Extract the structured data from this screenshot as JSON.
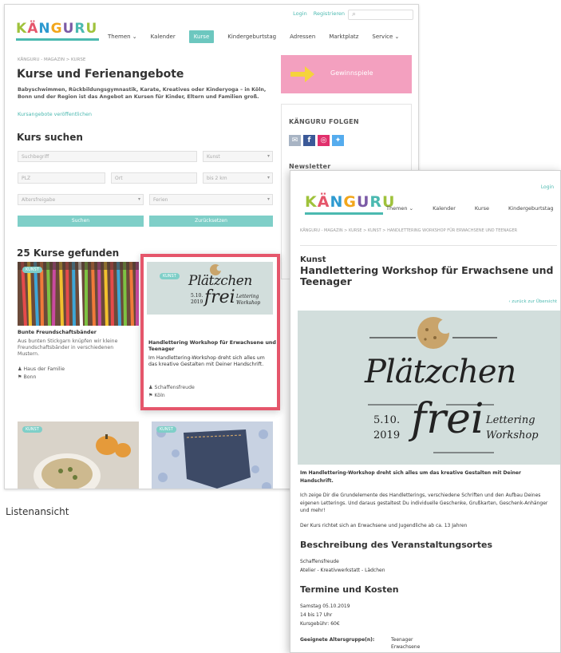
{
  "list": {
    "toplinks": [
      "Login",
      "Registrieren"
    ],
    "logo": "KÄNGURU",
    "nav": [
      "Themen ⌄",
      "Kalender",
      "Kurse",
      "Kindergeburtstag",
      "Adressen",
      "Marktplatz",
      "Service ⌄"
    ],
    "nav_active": 2,
    "breadcrumb": "KÄNGURU - MAGAZIN > KURSE",
    "title": "Kurse und Ferienangebote",
    "intro": "Babyschwimmen, Rückbildungsgymnastik, Karate, Kreatives oder Kinderyoga – in Köln, Bonn und der Region ist das Angebot an Kursen für Kinder, Eltern und Familien groß.",
    "publish_link": "Kursangebote veröffentlichen",
    "search_heading": "Kurs suchen",
    "fields": {
      "keyword": "Suchbegriff",
      "category": "Kunst",
      "plz": "PLZ",
      "ort": "Ort",
      "radius": "bis 2 km",
      "age": "Altersfreigabe",
      "holidays": "Ferien"
    },
    "buttons": {
      "search": "Suchen",
      "reset": "Zurücksetzen"
    },
    "results_heading": "25 Kurse gefunden",
    "cards": [
      {
        "badge": "KUNST",
        "title": "Bunte Freundschaftsbänder",
        "desc": "Aus bunten Stickgarn knüpfen wir kleine Freundschaftsbänder in verschiedenen Mustern.",
        "host": "Haus der Familie",
        "city": "Bonn"
      },
      {
        "badge": "KUNST",
        "title": "Handlettering Workshop für Erwachsene und Teenager",
        "desc": "Im Handlettering-Workshop dreht sich alles um das kreative Gestalten mit Deiner Handschrift.",
        "host": "Schaffensfreude",
        "city": "Köln"
      },
      {
        "badge": "KUNST"
      },
      {
        "badge": "KUNST"
      }
    ],
    "sidebar": {
      "promo": "Gewinnspiele",
      "follow": "KÄNGURU FOLGEN",
      "newsletter": "Newsletter"
    }
  },
  "caption": "Listenansicht",
  "detail": {
    "login": "Login",
    "logo": "KÄNGURU",
    "nav": [
      "Themen ⌄",
      "Kalender",
      "Kurse",
      "Kindergeburtstag"
    ],
    "breadcrumb": "KÄNGURU - MAGAZIN > KURSE > KUNST > HANDLETTERING WORKSHOP FÜR ERWACHSENE UND TEENAGER",
    "category": "Kunst",
    "title": "Handlettering Workshop für Erwachsene und Teenager",
    "back_link": "‹ zurück zur Übersicht",
    "poster": {
      "word1": "Plätzchen",
      "date1": "5.10.",
      "date2": "2019",
      "word2": "frei",
      "tag1": "Lettering",
      "tag2": "Workshop"
    },
    "lead": "Im Handlettering-Workshop dreht sich alles um das kreative Gestalten mit Deiner Handschrift.",
    "body": "Ich zeige Dir die Grundelemente des Handletterings, verschiedene Schriften und den Aufbau Deines eigenen Letterings. Und daraus gestaltest Du individuelle Geschenke, Grußkarten, Geschenk-Anhänger und mehr!",
    "audience": "Der Kurs richtet sich an Erwachsene und Jugendliche ab ca. 13 Jahren",
    "venue_heading": "Beschreibung des Veranstaltungsortes",
    "venue_name": "Schaffensfreude",
    "venue_desc": "Atelier - Kreativwerkstatt - Lädchen",
    "dates_heading": "Termine und Kosten",
    "date": "Samstag 05.10.2019",
    "time": "14 bis 17 Uhr",
    "fee": "Kursgebühr: 60€",
    "age_label": "Geeignete Altersgruppe(n):",
    "age_values": [
      "Teenager",
      "Erwachsene"
    ]
  }
}
